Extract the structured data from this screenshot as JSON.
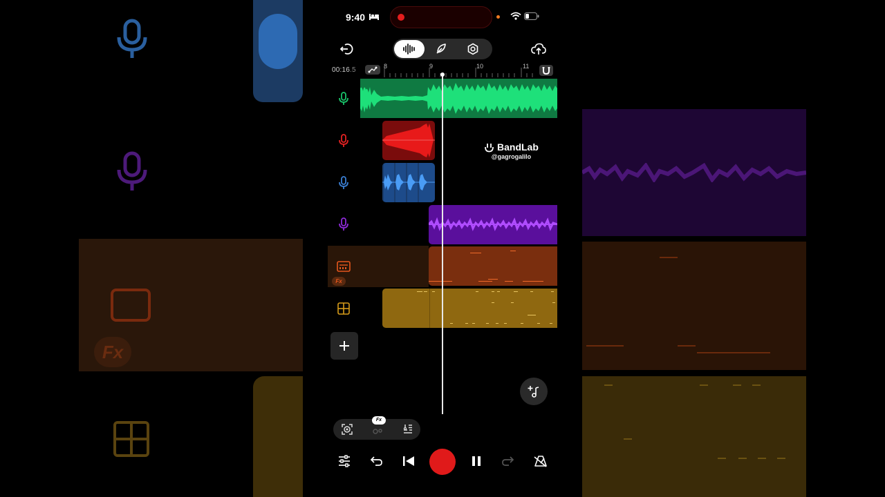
{
  "status_bar": {
    "time": "9:40",
    "icons": [
      "bed-icon",
      "wifi-icon",
      "battery-icon"
    ]
  },
  "toolbar": {
    "left_icon": "exit-icon",
    "tabs": [
      {
        "name": "tab-audio",
        "icon": "waveform-icon",
        "active": true
      },
      {
        "name": "tab-edit",
        "icon": "feather-icon",
        "active": false
      },
      {
        "name": "tab-settings",
        "icon": "hexagon-gear-icon",
        "active": false
      }
    ],
    "right_icon": "cloud-upload-icon"
  },
  "ruler": {
    "position_main": "00:16",
    "position_sub": ".5",
    "ticks": [
      "8",
      "9",
      "10",
      "11"
    ]
  },
  "tracks": [
    {
      "name": "vocal-1",
      "type": "voice",
      "color": "#19c46a"
    },
    {
      "name": "vocal-2",
      "type": "voice",
      "color": "#e52222"
    },
    {
      "name": "vocal-3",
      "type": "voice",
      "color": "#3a7fd4"
    },
    {
      "name": "vocal-4",
      "type": "voice",
      "color": "#8d2ad8"
    },
    {
      "name": "synth",
      "type": "instrument",
      "color": "#e7571d",
      "fx_label": "Fx"
    },
    {
      "name": "drums",
      "type": "drum-pad",
      "color": "#d79c1a"
    }
  ],
  "watermark": {
    "brand": "BandLab",
    "user": "@gagrogalilo"
  },
  "mini_toolbar": {
    "fx_badge": "Fx"
  },
  "colors": {
    "background": "#000000",
    "record": "#e01a1a",
    "green": "#19c46a",
    "red": "#e52222",
    "blue": "#3a7fd4",
    "purple": "#8d2ad8",
    "orange": "#e7571d",
    "yellow": "#d79c1a"
  }
}
